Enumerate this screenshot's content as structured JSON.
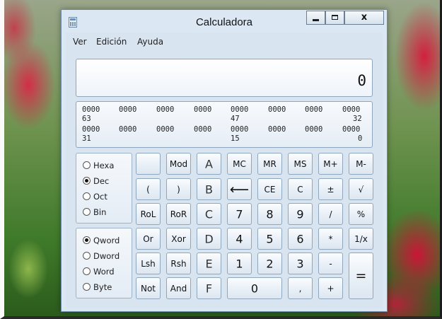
{
  "window": {
    "title": "Calculadora",
    "close_glyph": "x"
  },
  "menu": [
    "Ver",
    "Edición",
    "Ayuda"
  ],
  "display": {
    "value": "0"
  },
  "bits": {
    "row1": [
      "0000",
      "0000",
      "0000",
      "0000",
      "0000",
      "0000",
      "0000",
      "0000"
    ],
    "row1_indices": [
      "63",
      "47",
      "32"
    ],
    "row2": [
      "0000",
      "0000",
      "0000",
      "0000",
      "0000",
      "0000",
      "0000",
      "0000"
    ],
    "row2_indices": [
      "31",
      "15",
      "0"
    ]
  },
  "base": {
    "options": [
      "Hexa",
      "Dec",
      "Oct",
      "Bin"
    ],
    "selected": "Dec"
  },
  "word_size": {
    "options": [
      "Qword",
      "Dword",
      "Word",
      "Byte"
    ],
    "selected": "Qword"
  },
  "keys": {
    "mod": "Mod",
    "A": "A",
    "mc": "MC",
    "mr": "MR",
    "ms": "MS",
    "mplus": "M+",
    "mminus": "M-",
    "lparen": "(",
    "rparen": ")",
    "B": "B",
    "backspace": "⟵",
    "ce": "CE",
    "c": "C",
    "plusminus": "±",
    "sqrt": "√",
    "rol": "RoL",
    "ror": "RoR",
    "C": "C",
    "seven": "7",
    "eight": "8",
    "nine": "9",
    "divide": "/",
    "percent": "%",
    "or": "Or",
    "xor": "Xor",
    "D": "D",
    "four": "4",
    "five": "5",
    "six": "6",
    "multiply": "*",
    "reciprocal": "1/x",
    "lsh": "Lsh",
    "rsh": "Rsh",
    "E": "E",
    "one": "1",
    "two": "2",
    "three": "3",
    "minus": "-",
    "equals": "=",
    "not": "Not",
    "and": "And",
    "F": "F",
    "zero": "0",
    "decimal": ",",
    "plus": "+"
  }
}
